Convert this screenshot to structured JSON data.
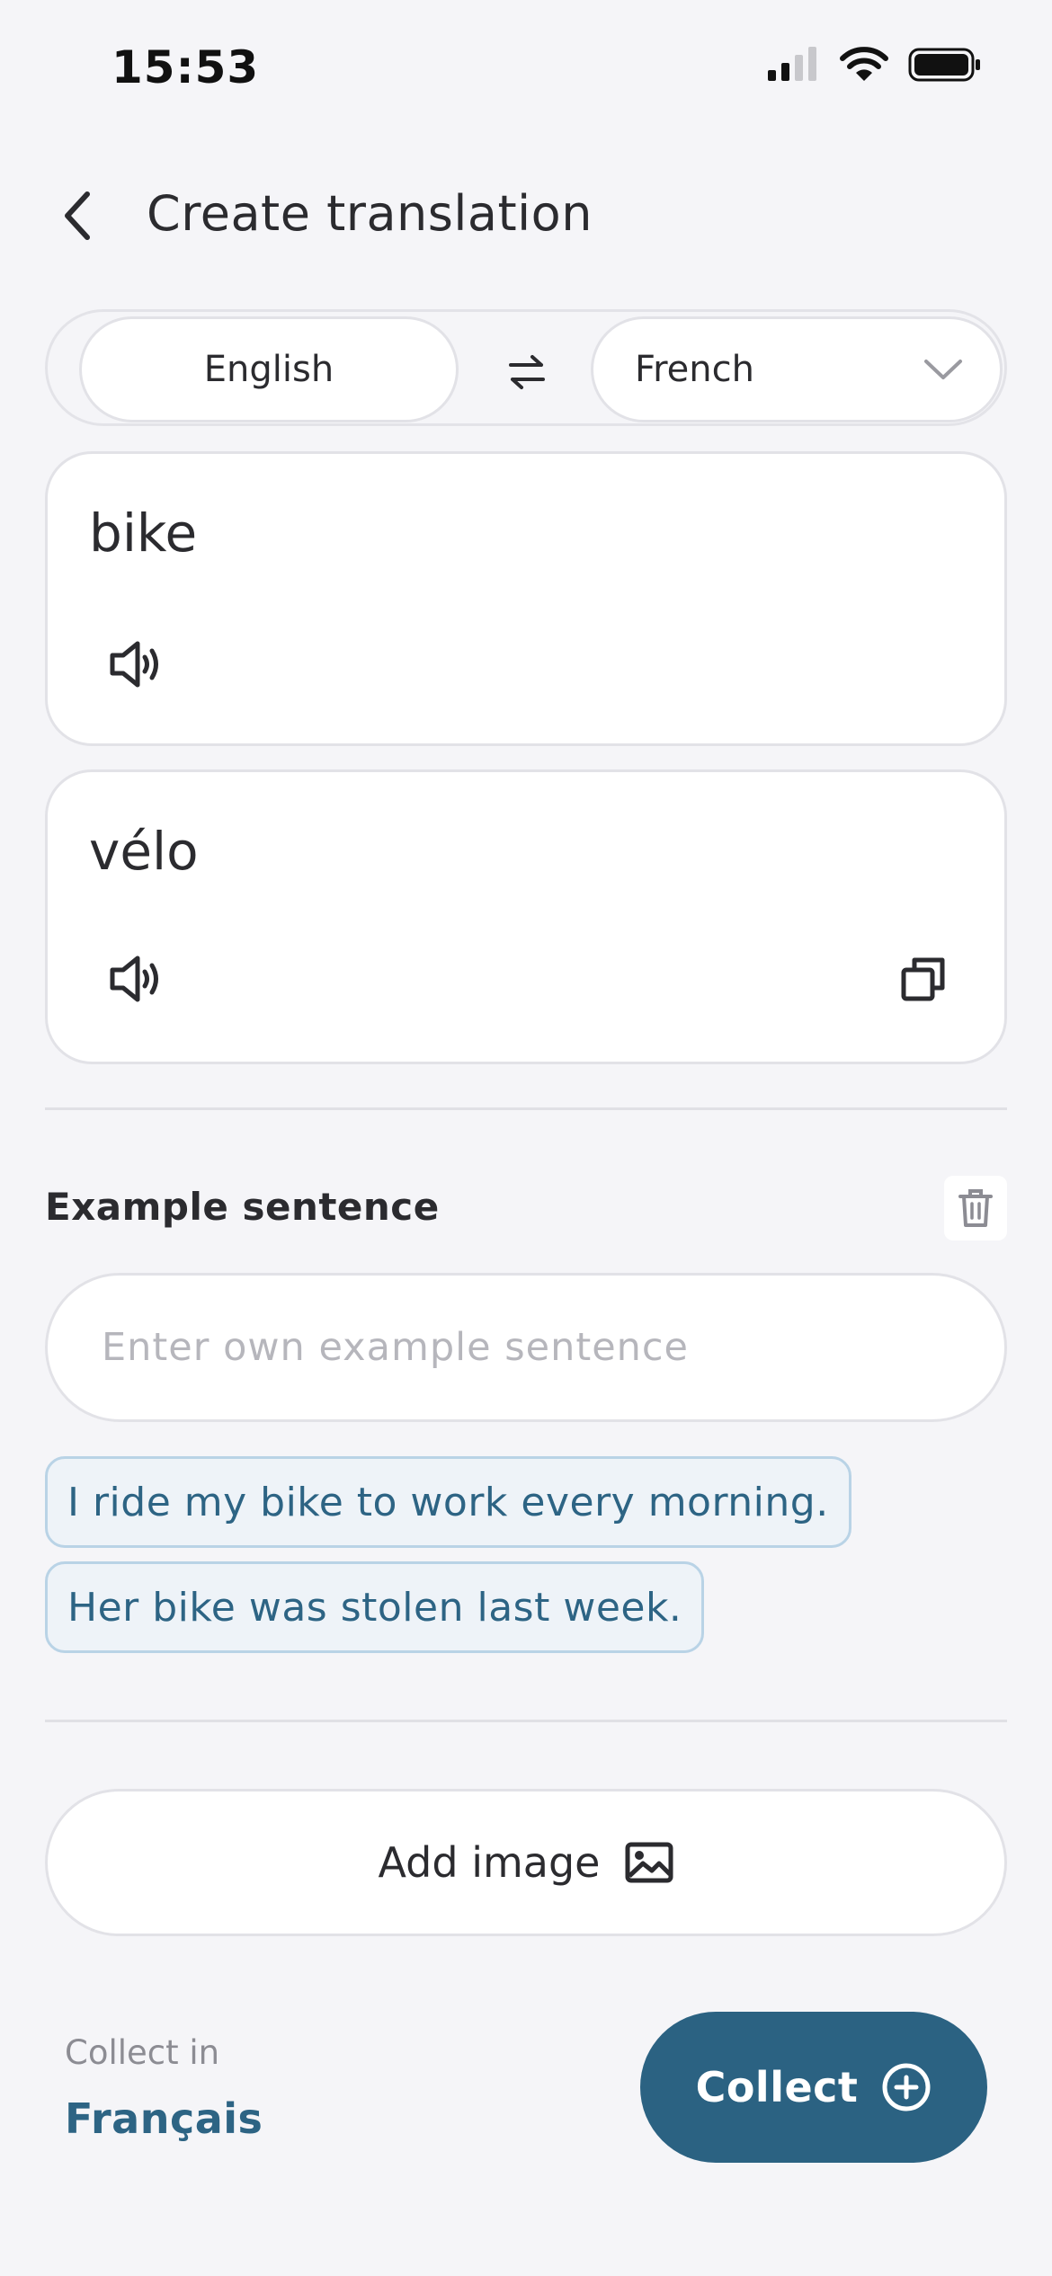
{
  "status_bar": {
    "time": "15:53"
  },
  "header": {
    "title": "Create translation"
  },
  "languages": {
    "source": "English",
    "target": "French"
  },
  "source_card": {
    "word": "bike"
  },
  "target_card": {
    "word": "vélo"
  },
  "example": {
    "title": "Example sentence",
    "placeholder": "Enter own example sentence",
    "suggestions": [
      "I ride my bike to work every morning.",
      "Her bike was stolen last week."
    ]
  },
  "add_image": {
    "label": "Add image"
  },
  "collect": {
    "label": "Collect in",
    "language": "Français",
    "button_label": "Collect"
  },
  "colors": {
    "accent": "#2b6282",
    "chip_bg": "#eef3f8",
    "chip_border": "#b9d3e6",
    "background": "#f5f5f8"
  },
  "icons": {
    "back": "chevron-left-icon",
    "swap": "swap-arrows-icon",
    "dropdown": "chevron-down-icon",
    "speaker": "speaker-icon",
    "copy": "copy-icon",
    "trash": "trash-icon",
    "image": "image-icon",
    "plus": "plus-circle-icon"
  }
}
